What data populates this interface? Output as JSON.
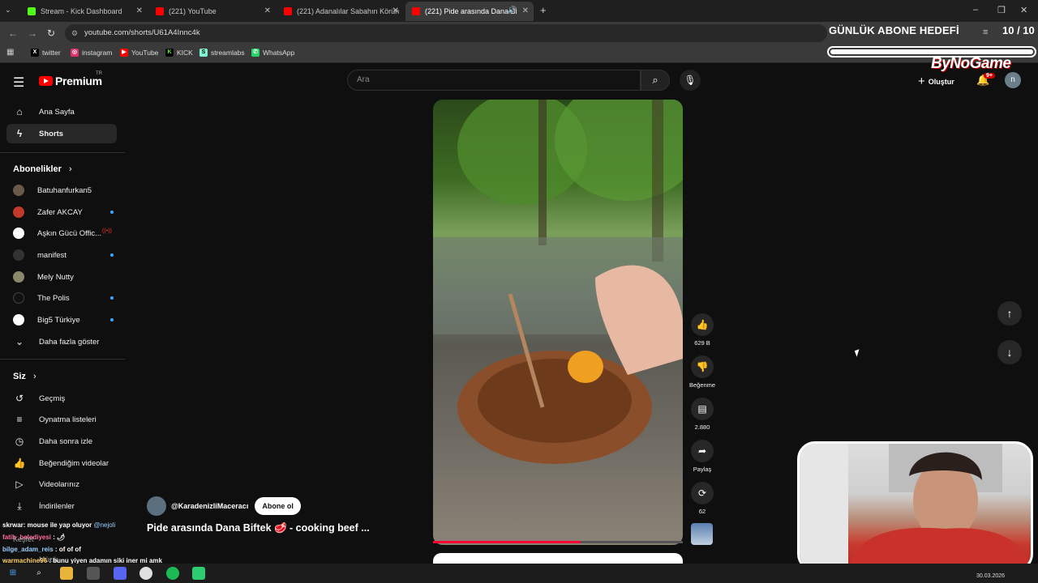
{
  "browser": {
    "tabs": [
      {
        "label": "Stream - Kick Dashboard",
        "color": "#53fc18"
      },
      {
        "label": "(221) YouTube",
        "color": "#ff0000"
      },
      {
        "label": "(221) Adanalılar Sabahın Körün",
        "color": "#ff0000"
      },
      {
        "label": "(221) Pide arasında Dana Bi",
        "color": "#ff0000"
      }
    ],
    "url": "youtube.com/shorts/U61A4Innc4k",
    "bookmarks": [
      {
        "label": "twitter",
        "glyph": "X",
        "color": "#000000"
      },
      {
        "label": "instagram",
        "glyph": "◎",
        "color": "#e1306c"
      },
      {
        "label": "YouTube",
        "glyph": "▶",
        "color": "#ff0000"
      },
      {
        "label": "KICK",
        "glyph": "K",
        "color": "#53fc18"
      },
      {
        "label": "streamlabs",
        "glyph": "S",
        "color": "#80f5d2"
      },
      {
        "label": "WhatsApp",
        "glyph": "✆",
        "color": "#25d366"
      }
    ]
  },
  "overlay": {
    "goal_title": "GÜNLÜK ABONE HEDEFİ",
    "goal_count": "10 / 10",
    "goal_progress": 1.0,
    "brand": "ByNoGame"
  },
  "youtube": {
    "logo_word": "Premium",
    "logo_region": "TR",
    "search_placeholder": "Ara",
    "create_label": "Oluştur",
    "notif_badge": "9+",
    "avatar_letter": "n",
    "sidebar": {
      "main": [
        {
          "label": "Ana Sayfa",
          "icon": "home-icon"
        },
        {
          "label": "Shorts",
          "icon": "shorts-icon"
        }
      ],
      "subs_title": "Abonelikler",
      "subs": [
        {
          "label": "Batuhanfurkan5",
          "color": "#6b5a4a",
          "badge": ""
        },
        {
          "label": "Zafer AKCAY",
          "color": "#c0392b",
          "badge": "dot"
        },
        {
          "label": "Aşkın Gücü Offic...",
          "color": "#ffffff",
          "badge": "live"
        },
        {
          "label": "manifest",
          "color": "#333333",
          "badge": "dot"
        },
        {
          "label": "Mely Nutty",
          "color": "#8a8a6a",
          "badge": ""
        },
        {
          "label": "The Polis",
          "color": "#111111",
          "badge": "dot"
        },
        {
          "label": "Big5 Türkiye",
          "color": "#ffffff",
          "badge": "dot"
        }
      ],
      "show_more": "Daha fazla göster",
      "you_title": "Siz",
      "you": [
        {
          "label": "Geçmiş",
          "icon": "history-icon"
        },
        {
          "label": "Oynatma listeleri",
          "icon": "playlist-icon"
        },
        {
          "label": "Daha sonra izle",
          "icon": "clock-icon"
        },
        {
          "label": "Beğendiğim videolar",
          "icon": "like-icon"
        },
        {
          "label": "Videolarınız",
          "icon": "video-icon"
        },
        {
          "label": "İndirilenler",
          "icon": "download-icon"
        }
      ]
    },
    "video": {
      "channel": "@KaradenizliMaceracı",
      "subscribe": "Abone ol",
      "title": "Pide arasında Dana Biftek 🥩 - cooking beef ...",
      "progress": 0.59,
      "actions": {
        "like": "629 B",
        "dislike": "Beğenme",
        "comments": "2.880",
        "share": "Paylaş",
        "remix": "62"
      }
    }
  },
  "chat": [
    {
      "user": "skrwar",
      "msg": ": mouse ile yap oluyor ",
      "mention": "@nejoli",
      "color": "#ffffff"
    },
    {
      "user": "fatih_belediyesi",
      "msg": " : 🌶",
      "mention": "",
      "color": "#ff6b9a"
    },
    {
      "user": "bilge_adam_reis",
      "msg": " : of of of",
      "mention": "",
      "color": "#9ad0ff"
    },
    {
      "user": "warmachine96",
      "msg": " : bunu yiyen adamın siki iner mi amk",
      "mention": "",
      "color": "#ffd166"
    }
  ],
  "chat_partial": [
    "Keşfet",
    "Müzik"
  ],
  "system": {
    "date": "30.03.2026"
  }
}
